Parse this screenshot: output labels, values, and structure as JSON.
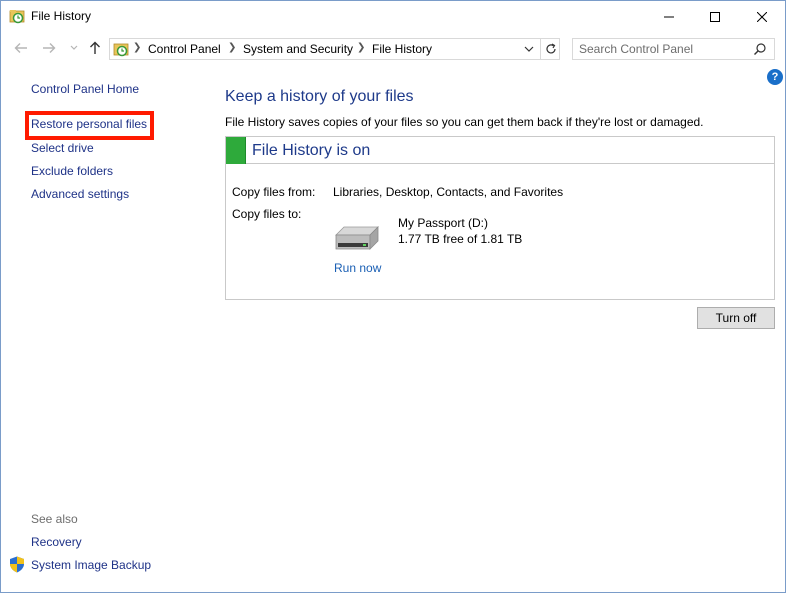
{
  "window": {
    "title": "File History"
  },
  "address_bar": {
    "crumbs": [
      "Control Panel",
      "System and Security",
      "File History"
    ]
  },
  "search": {
    "placeholder": "Search Control Panel"
  },
  "help": {
    "label": "?"
  },
  "left_pane": {
    "home": "Control Panel Home",
    "links": [
      "Restore personal files",
      "Select drive",
      "Exclude folders",
      "Advanced settings"
    ],
    "see_also_label": "See also",
    "see_also": [
      "Recovery",
      "System Image Backup"
    ]
  },
  "main": {
    "heading": "Keep a history of your files",
    "description": "File History saves copies of your files so you can get them back if they're lost or damaged.",
    "status_title": "File History is on",
    "copy_from_label": "Copy files from:",
    "copy_from_value": "Libraries, Desktop, Contacts, and Favorites",
    "copy_to_label": "Copy files to:",
    "drive_name": "My Passport (D:)",
    "drive_free": "1.77 TB free of 1.81 TB",
    "run_now": "Run now",
    "turn_off": "Turn off"
  },
  "colors": {
    "link": "#1e3287",
    "heading": "#1e3a8a",
    "status_green": "#2eaa3b",
    "highlight": "#ff1a00"
  }
}
